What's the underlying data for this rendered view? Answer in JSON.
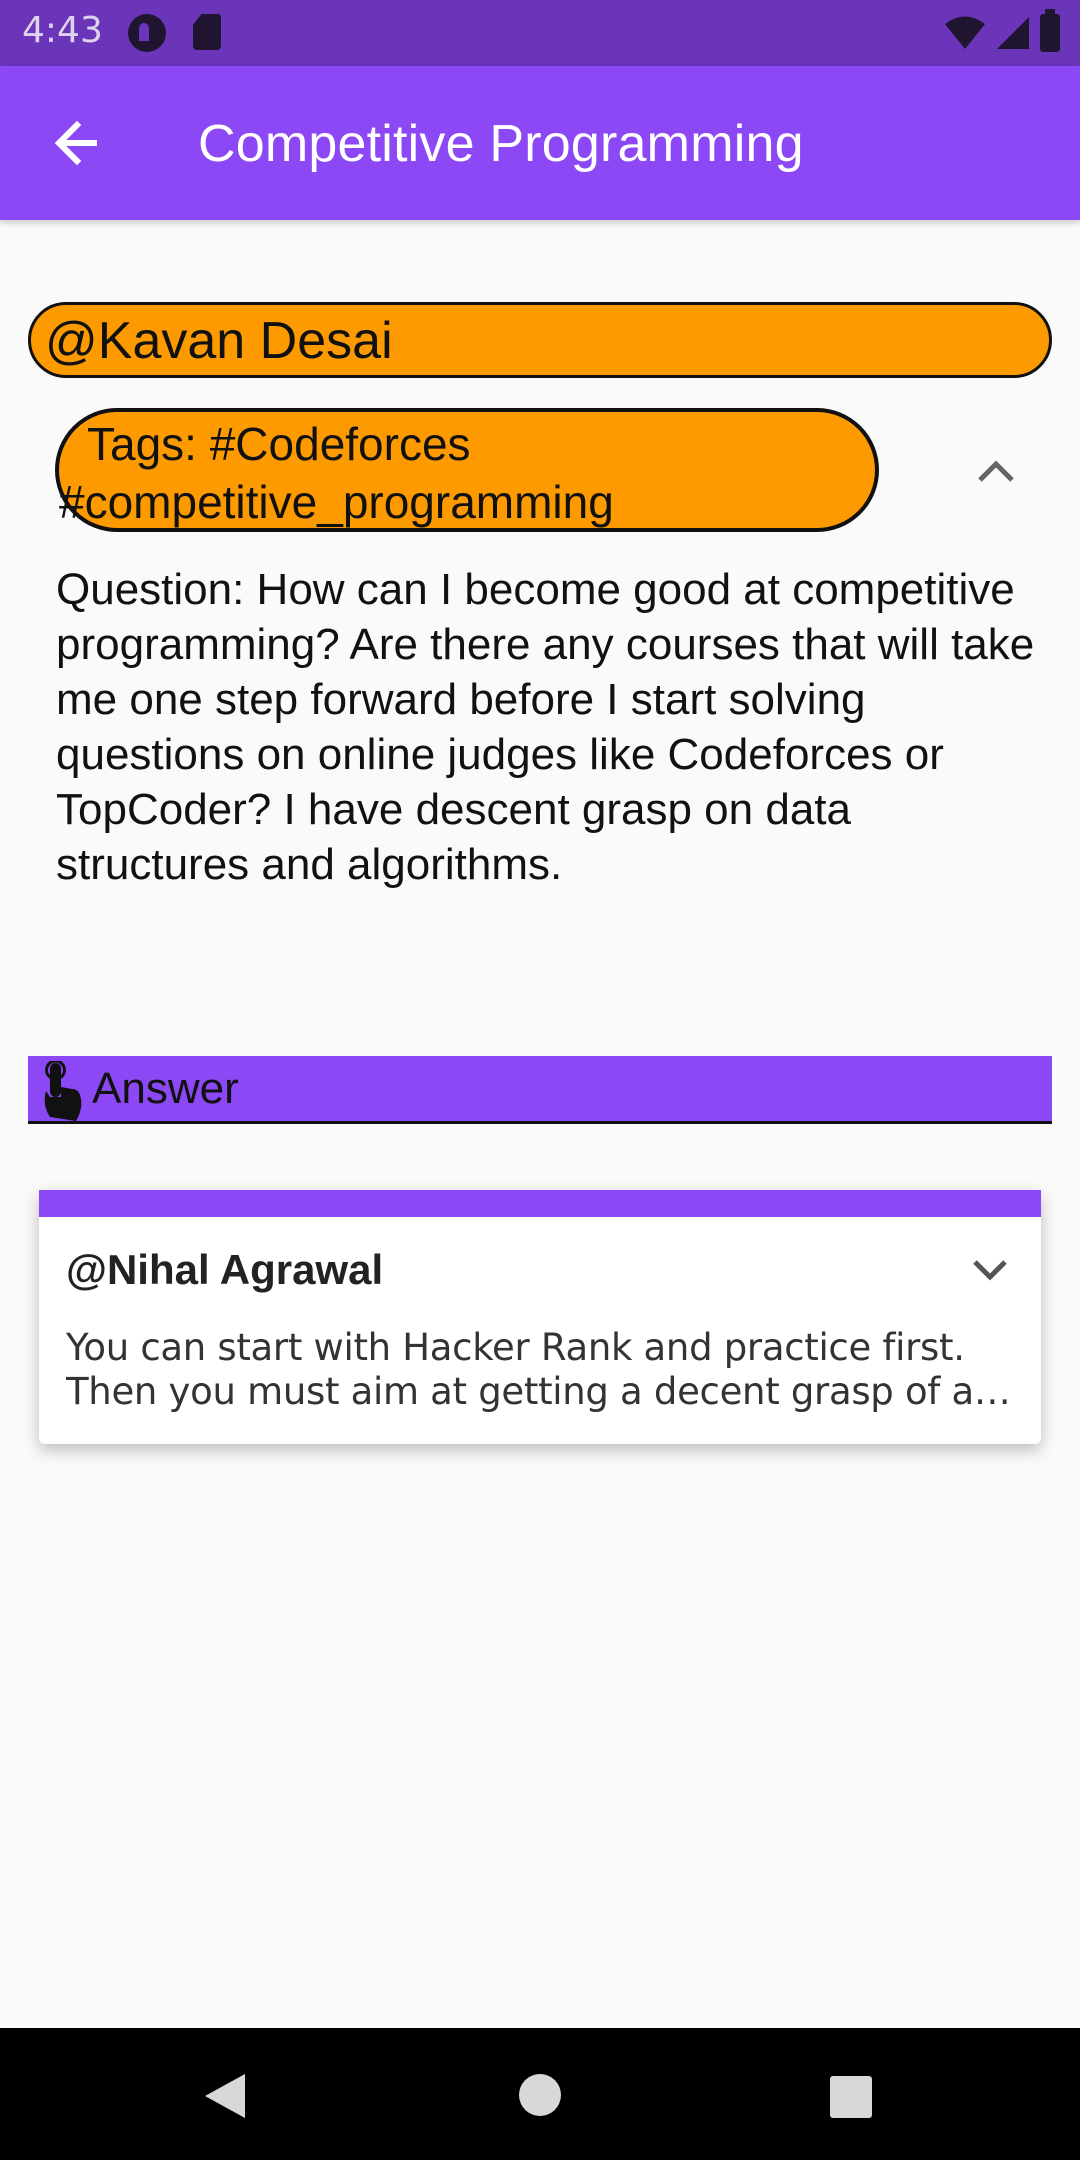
{
  "status_bar": {
    "time": "4:43",
    "icons": [
      "notification-app-icon",
      "sd-card-icon",
      "wifi-icon",
      "cell-signal-icon",
      "battery-icon"
    ]
  },
  "app_bar": {
    "title": "Competitive Programming",
    "back_icon": "arrow-left-icon"
  },
  "question_post": {
    "author": "@Kavan Desai",
    "tags_line1": "Tags: #Codeforces",
    "tags_line2": "#competitive_programming",
    "expand_icon": "chevron-up-icon",
    "question_text": "Question: How can I become good at competitive programming? Are there any courses that will take me one step forward before I start solving questions on online judges like Codeforces or TopCoder? I have descent grasp on data structures and algorithms."
  },
  "answer_button": {
    "label": "Answer",
    "icon": "touch-hand-icon"
  },
  "answers": [
    {
      "author": "@Nihal Agrawal",
      "text": "You can start with Hacker Rank and practice first. Then you must aim at getting a decent grasp of all the Data Structures and Algorithms",
      "expand_icon": "chevron-down-icon"
    }
  ],
  "colors": {
    "status_bar": "#6a35b8",
    "app_bar": "#8c48f5",
    "pill": "#fd9a00",
    "background": "#fafafa"
  }
}
